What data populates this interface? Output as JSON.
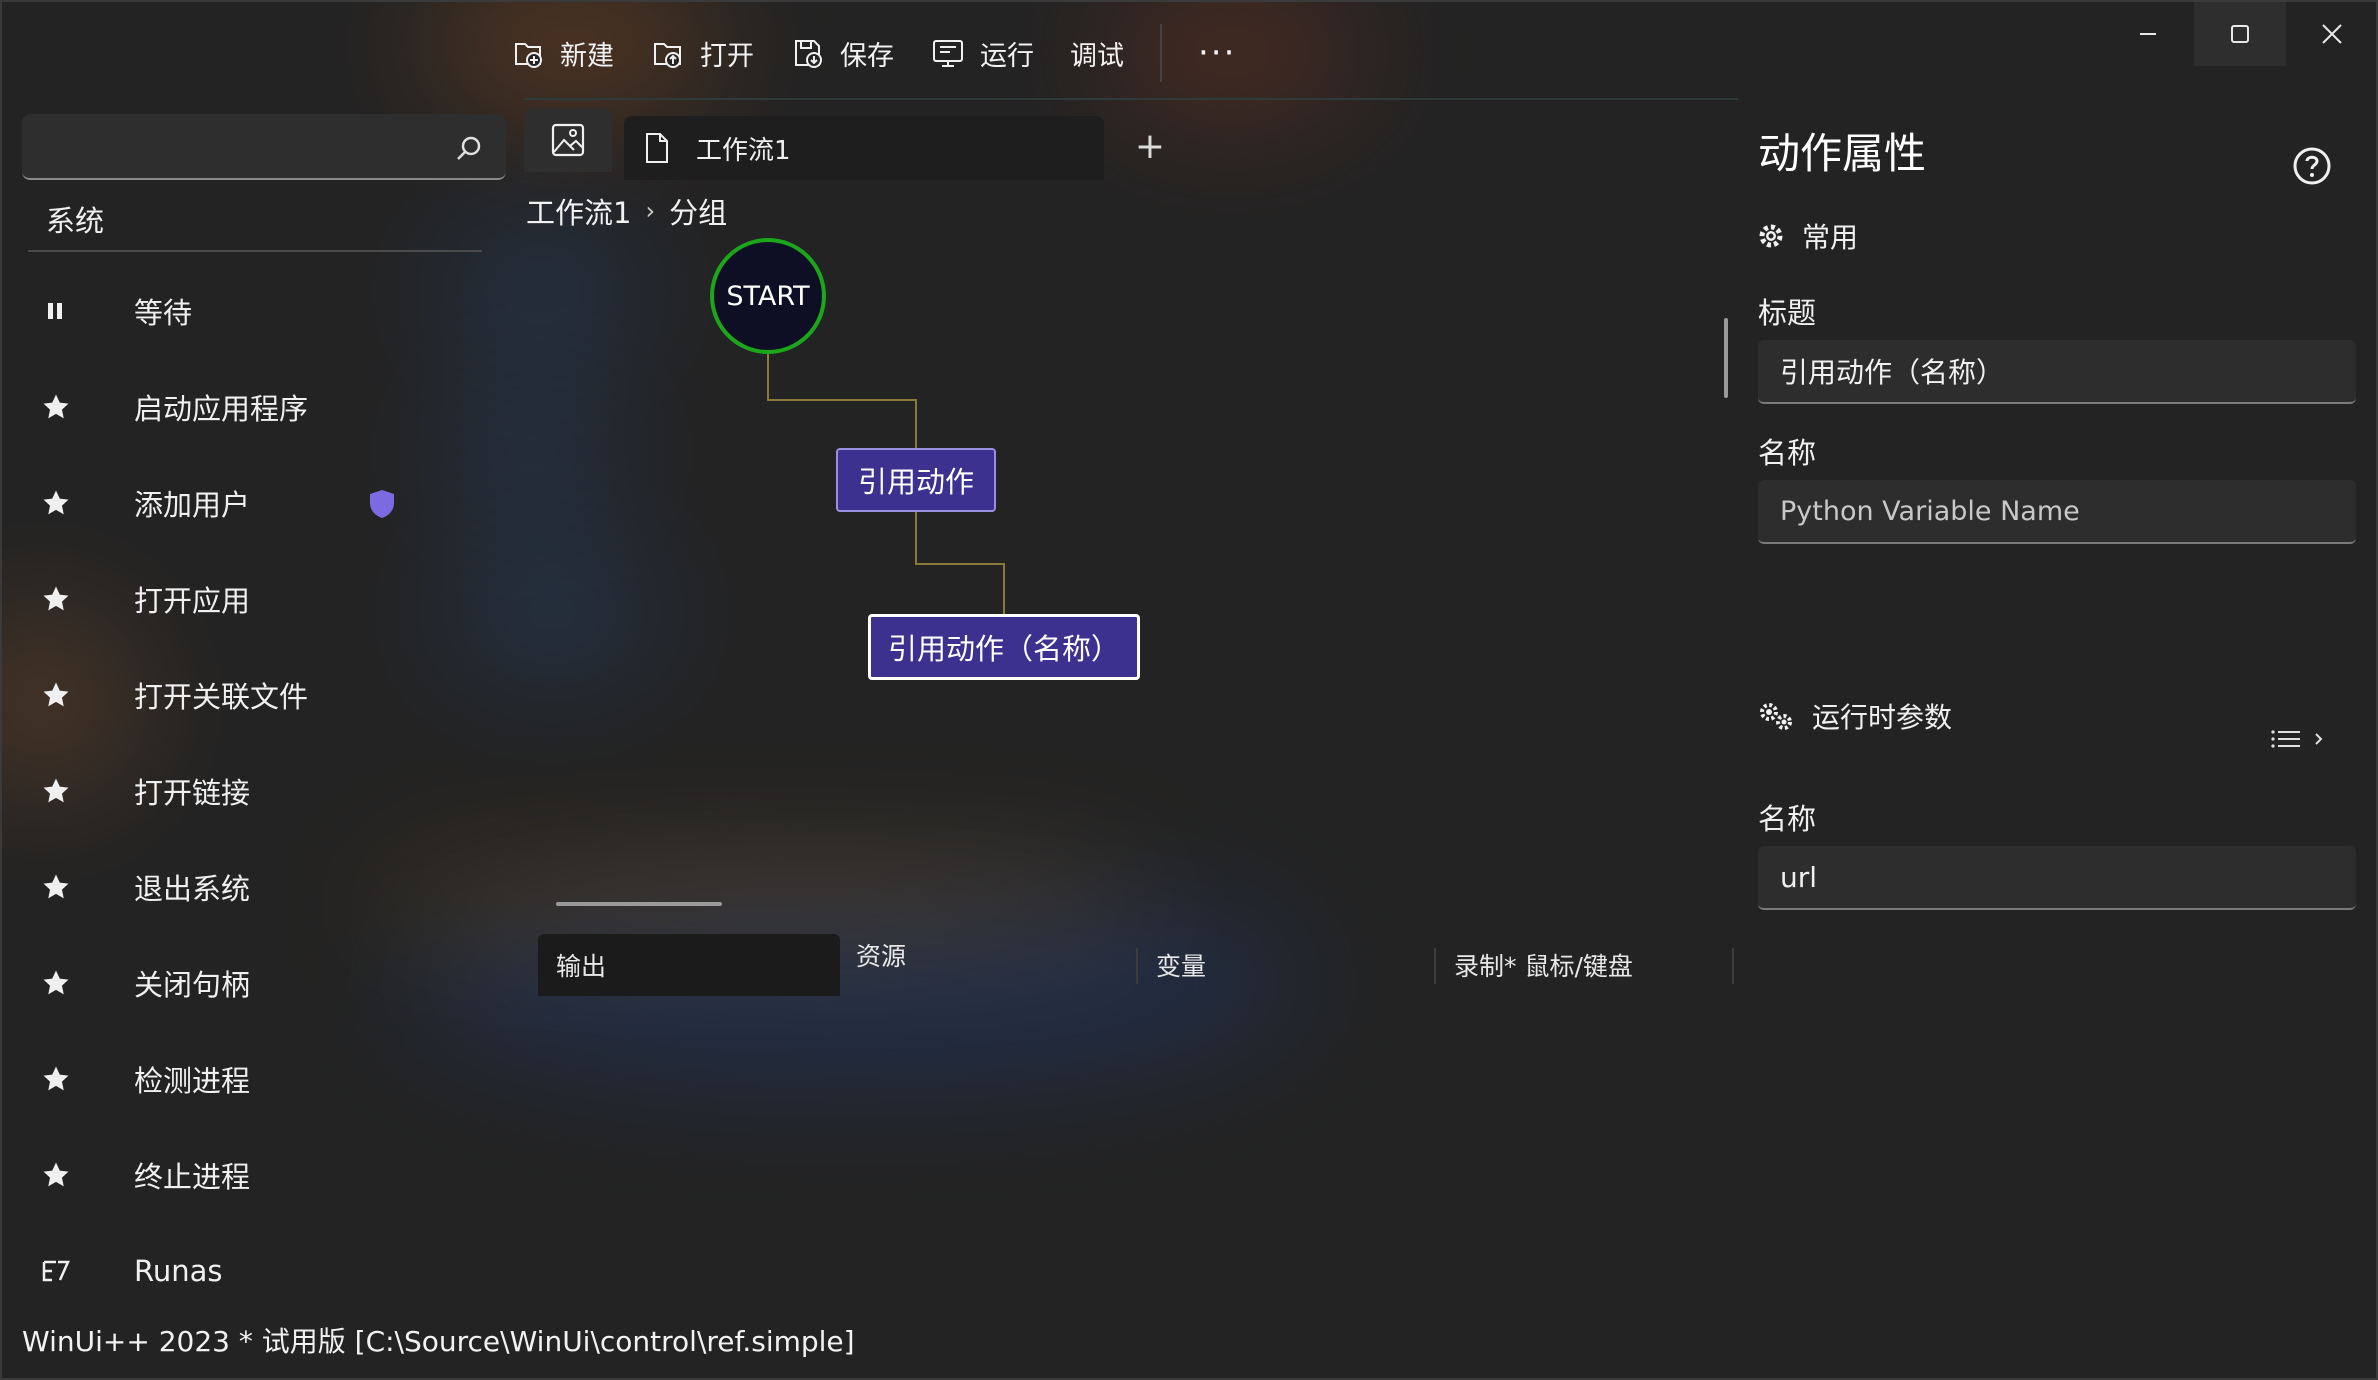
{
  "toolbar": {
    "items": [
      {
        "label": "新建",
        "icon": "new-file-icon"
      },
      {
        "label": "打开",
        "icon": "open-folder-icon"
      },
      {
        "label": "保存",
        "icon": "save-icon"
      },
      {
        "label": "运行",
        "icon": "run-icon"
      },
      {
        "label": "调试",
        "icon": ""
      }
    ],
    "more": "···"
  },
  "sidebar": {
    "search_placeholder": "",
    "section_title": "系统",
    "items": [
      {
        "label": "等待",
        "icon": "pause-icon"
      },
      {
        "label": "启动应用程序",
        "icon": "star-icon"
      },
      {
        "label": "添加用户",
        "icon": "star-icon",
        "badge": "shield-icon"
      },
      {
        "label": "打开应用",
        "icon": "star-icon"
      },
      {
        "label": "打开关联文件",
        "icon": "star-icon"
      },
      {
        "label": "打开链接",
        "icon": "star-icon"
      },
      {
        "label": "退出系统",
        "icon": "star-icon"
      },
      {
        "label": "关闭句柄",
        "icon": "star-icon"
      },
      {
        "label": "检测进程",
        "icon": "star-icon"
      },
      {
        "label": "终止进程",
        "icon": "star-icon"
      },
      {
        "label": "Runas",
        "icon": "runas-icon"
      }
    ]
  },
  "tabs": {
    "doc_label": "工作流1",
    "add": "+"
  },
  "breadcrumb": {
    "items": [
      "工作流1",
      "分组"
    ],
    "separator": "›"
  },
  "canvas": {
    "start": "START",
    "nodes": [
      "引用动作",
      "引用动作（名称）"
    ]
  },
  "bottom_tabs": [
    "输出",
    "资源",
    "变量",
    "录制* 鼠标/键盘"
  ],
  "properties": {
    "title": "动作属性",
    "common_group": "常用",
    "title_label": "标题",
    "title_value": "引用动作（名称）",
    "name_label": "名称",
    "name_placeholder": "Python Variable Name",
    "runtime_group": "运行时参数",
    "runtime_name_label": "名称",
    "runtime_name_value": "url"
  },
  "status_bar": "WinUi++ 2023 * 试用版 [C:\\Source\\WinUi\\control\\ref.simple]",
  "colors": {
    "node_fill": "#3d3190",
    "start_border": "#1aa81a",
    "connector": "#8a7a3a",
    "shield": "#7b6ae0"
  }
}
